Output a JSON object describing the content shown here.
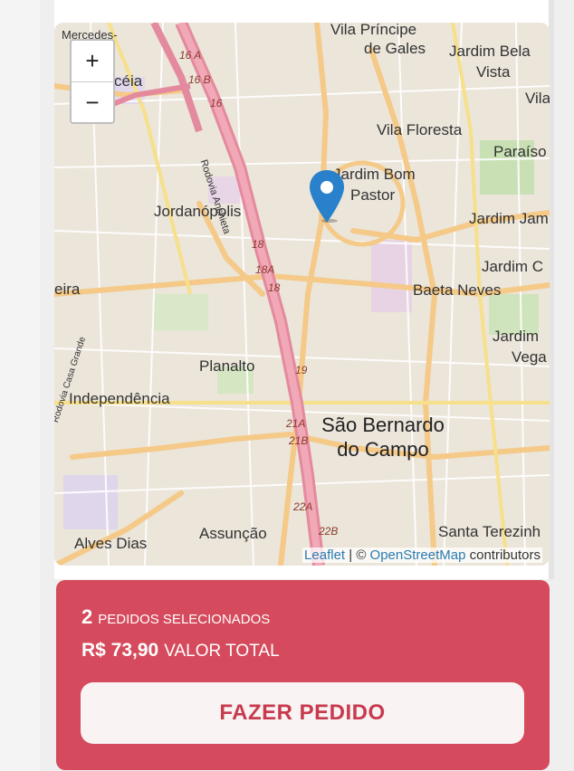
{
  "map": {
    "zoom_in_label": "+",
    "zoom_out_label": "−",
    "labels": {
      "mercedes": "Mercedes-",
      "ceia": "céia",
      "vila_principe": "Vila Príncipe",
      "de_gales": "de Gales",
      "jardim_bela": "Jardim Bela",
      "vista": "Vista",
      "vila_floresta": "Vila Floresta",
      "vila_edge": "Vila",
      "paraiso": "Paraíso",
      "jardim_bom": "Jardim Bom",
      "pastor": "Pastor",
      "jordanopolis": "Jordanópolis",
      "jardim_jam": "Jardim Jam",
      "jardim_c": "Jardim C",
      "eira": "eira",
      "baeta_neves": "Baeta Neves",
      "jardim_edge": "Jardim",
      "vega": "Vega",
      "planalto": "Planalto",
      "independencia": "Independência",
      "sao_bernardo": "São Bernardo",
      "do_campo": "do Campo",
      "assuncao": "Assunção",
      "alves_dias": "Alves Dias",
      "santa_terezinha": "Santa Terezinh",
      "rodovia_anchieta": "Rodovia Anchieta",
      "casa_grande": "Rodovia Casa Grande"
    },
    "road_numbers": [
      "16 A",
      "16 B",
      "16",
      "18",
      "18A",
      "18",
      "19",
      "21A",
      "21B",
      "22A",
      "22B"
    ],
    "attribution": {
      "leaflet": "Leaflet",
      "separator": " | © ",
      "osm": "OpenStreetMap",
      "contributors": " contributors"
    }
  },
  "order": {
    "count": "2",
    "count_label": "PEDIDOS SELECIONADOS",
    "total": "R$ 73,90",
    "total_label": "VALOR TOTAL",
    "button_label": "FAZER PEDIDO"
  },
  "colors": {
    "order_bg": "#d54a5c",
    "button_text": "#c83a4e",
    "marker": "#2a81cb",
    "highway": "#e892a2"
  }
}
